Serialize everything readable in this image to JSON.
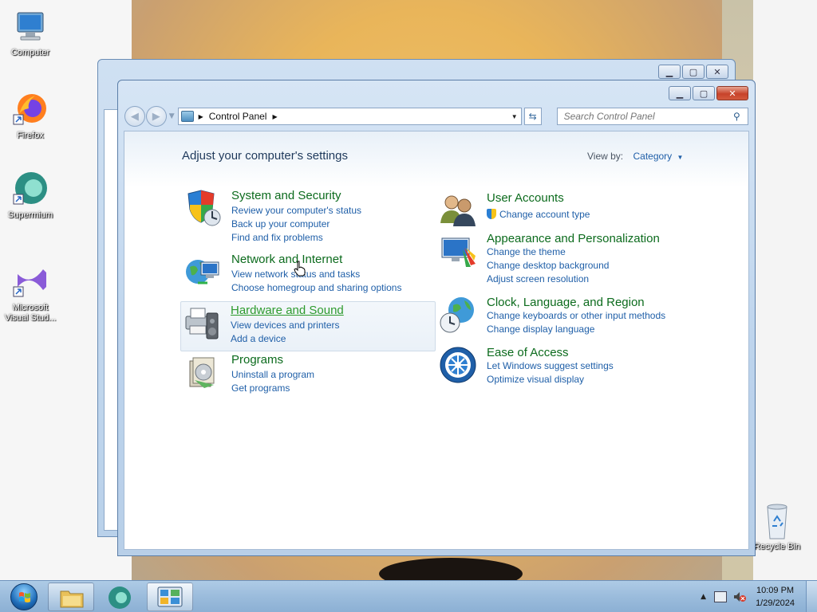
{
  "desktop": {
    "icons": [
      {
        "label": "Computer"
      },
      {
        "label": "Firefox"
      },
      {
        "label": "Supermium"
      },
      {
        "label": "Microsoft Visual Stud..."
      },
      {
        "label": "Recycle Bin"
      }
    ]
  },
  "window": {
    "address": {
      "segment": "Control Panel"
    },
    "search": {
      "placeholder": "Search Control Panel"
    },
    "heading": "Adjust your computer's settings",
    "view_by": {
      "label": "View by:",
      "value": "Category"
    },
    "categories": [
      {
        "title": "System and Security",
        "links": [
          "Review your computer's status",
          "Back up your computer",
          "Find and fix problems"
        ]
      },
      {
        "title": "Network and Internet",
        "links": [
          "View network status and tasks",
          "Choose homegroup and sharing options"
        ]
      },
      {
        "title": "Hardware and Sound",
        "links": [
          "View devices and printers",
          "Add a device"
        ]
      },
      {
        "title": "Programs",
        "links": [
          "Uninstall a program",
          "Get programs"
        ]
      },
      {
        "title": "User Accounts",
        "links": [
          "Change account type"
        ]
      },
      {
        "title": "Appearance and Personalization",
        "links": [
          "Change the theme",
          "Change desktop background",
          "Adjust screen resolution"
        ]
      },
      {
        "title": "Clock, Language, and Region",
        "links": [
          "Change keyboards or other input methods",
          "Change display language"
        ]
      },
      {
        "title": "Ease of Access",
        "links": [
          "Let Windows suggest settings",
          "Optimize visual display"
        ]
      }
    ]
  },
  "taskbar": {
    "clock": {
      "time": "10:09 PM",
      "date": "1/29/2024"
    }
  },
  "colors": {
    "category_title": "#0c6b1d",
    "link": "#1f5fa8",
    "heading": "#1e395b"
  }
}
